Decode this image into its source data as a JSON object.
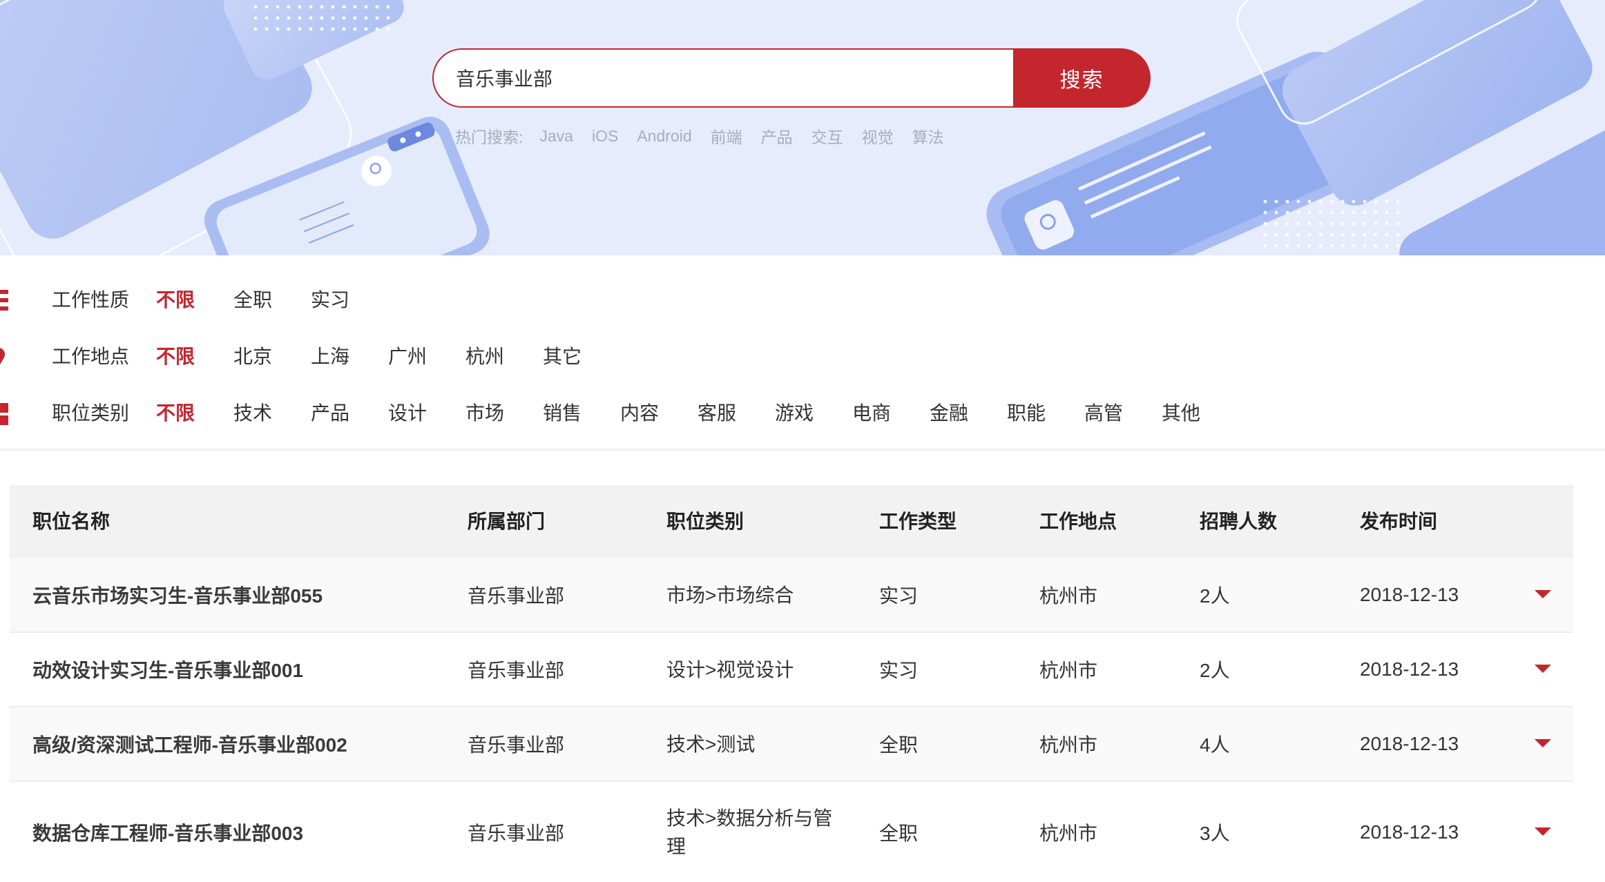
{
  "search": {
    "value": "音乐事业部",
    "button_label": "搜索",
    "hot_label": "热门搜索:",
    "hot_items": [
      "Java",
      "iOS",
      "Android",
      "前端",
      "产品",
      "交互",
      "视觉",
      "算法"
    ]
  },
  "filters": {
    "job_nature": {
      "title": "工作性质",
      "options": [
        "不限",
        "全职",
        "实习"
      ],
      "selected": "不限"
    },
    "location": {
      "title": "工作地点",
      "options": [
        "不限",
        "北京",
        "上海",
        "广州",
        "杭州",
        "其它"
      ],
      "selected": "不限"
    },
    "category": {
      "title": "职位类别",
      "options": [
        "不限",
        "技术",
        "产品",
        "设计",
        "市场",
        "销售",
        "内容",
        "客服",
        "游戏",
        "电商",
        "金融",
        "职能",
        "高管",
        "其他"
      ],
      "selected": "不限"
    }
  },
  "table": {
    "headers": [
      "职位名称",
      "所属部门",
      "职位类别",
      "工作类型",
      "工作地点",
      "招聘人数",
      "发布时间"
    ],
    "rows": [
      {
        "name": "云音乐市场实习生-音乐事业部055",
        "dept": "音乐事业部",
        "category": "市场>市场综合",
        "type": "实习",
        "location": "杭州市",
        "count": "2人",
        "date": "2018-12-13"
      },
      {
        "name": "动效设计实习生-音乐事业部001",
        "dept": "音乐事业部",
        "category": "设计>视觉设计",
        "type": "实习",
        "location": "杭州市",
        "count": "2人",
        "date": "2018-12-13"
      },
      {
        "name": "高级/资深测试工程师-音乐事业部002",
        "dept": "音乐事业部",
        "category": "技术>测试",
        "type": "全职",
        "location": "杭州市",
        "count": "4人",
        "date": "2018-12-13"
      },
      {
        "name": "数据仓库工程师-音乐事业部003",
        "dept": "音乐事业部",
        "category": "技术>数据分析与管理",
        "type": "全职",
        "location": "杭州市",
        "count": "3人",
        "date": "2018-12-13"
      }
    ]
  },
  "colors": {
    "accent": "#c4262e",
    "banner_bg": "#e6ecfb",
    "header_bg": "#f2f2f2"
  }
}
